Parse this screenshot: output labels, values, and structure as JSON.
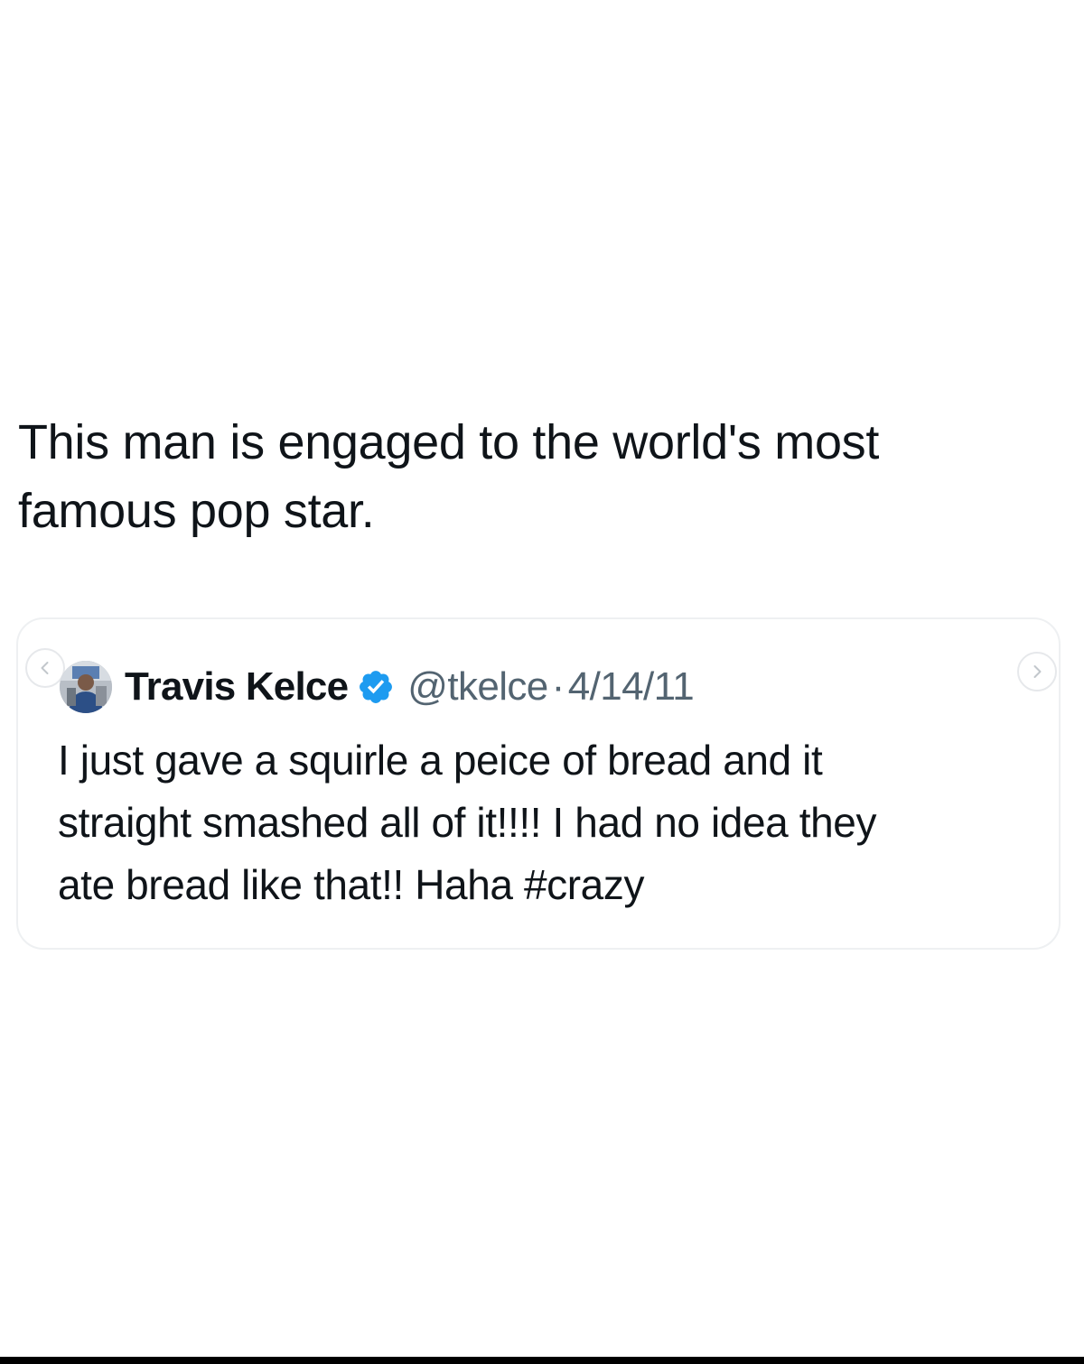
{
  "post": {
    "text": "This man is engaged to the world's most\nfamous pop star."
  },
  "quoted_post": {
    "display_name": "Travis Kelce",
    "handle": "@tkelce",
    "separator": "·",
    "date": "4/14/11",
    "text": "I just gave a squirle a peice of bread and it\nstraight smashed all of it!!!! I had no idea they\nate bread like that!! Haha #crazy",
    "verified_color": "#1d9bf0",
    "avatar_icon": "profile-photo"
  },
  "carousel": {
    "prev_icon": "chevron-left-icon",
    "next_icon": "chevron-right-icon"
  },
  "colors": {
    "text": "#0f1419",
    "secondary_text": "#536471",
    "card_border": "#eef0f2"
  }
}
